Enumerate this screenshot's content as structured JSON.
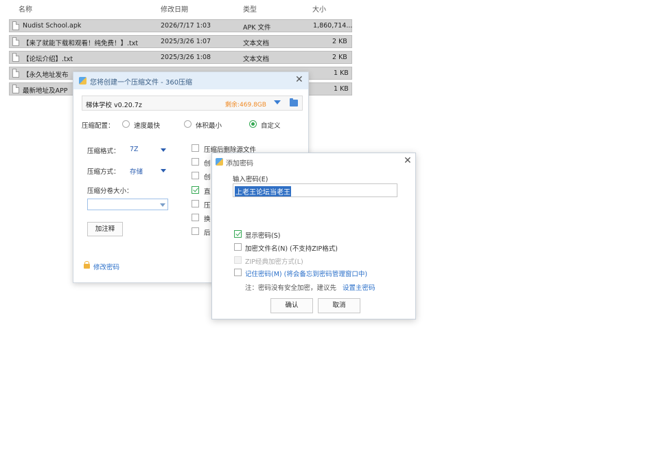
{
  "explorer": {
    "columns": [
      "名称",
      "修改日期",
      "类型",
      "大小"
    ],
    "files": [
      {
        "name": "Nudist School.apk",
        "date": "2026/7/17 1:03",
        "type": "APK 文件",
        "size": "1,860,714..."
      },
      {
        "name": "【来了就能下载和观看！纯免费！】.txt",
        "date": "2025/3/26 1:07",
        "type": "文本文档",
        "size": "2 KB"
      },
      {
        "name": "【论坛介绍】.txt",
        "date": "2025/3/26 1:08",
        "type": "文本文档",
        "size": "2 KB"
      },
      {
        "name": "【永久地址发布",
        "date": "",
        "type": "",
        "size": "1 KB"
      },
      {
        "name": "最新地址及APP",
        "date": "",
        "type": "",
        "size": "1 KB"
      }
    ]
  },
  "dialog360": {
    "title": "您将创建一个压缩文件 - 360压缩",
    "archive_name": "梯体学校  v0.20.7z",
    "free_space": "剩余:469.8GB",
    "config_label": "压缩配置：",
    "options": [
      "速度最快",
      "体积最小",
      "自定义"
    ],
    "selected_option": "自定义",
    "format_label": "压缩格式：",
    "format_value": "7Z",
    "method_label": "压缩方式：",
    "method_value": "存储",
    "split_label": "压缩分卷大小：",
    "split_value": "",
    "comment_button": "加注释",
    "change_password": "修改密码",
    "checkboxes": [
      {
        "label": "压缩后删除源文件",
        "checked": false
      },
      {
        "label": "创",
        "checked": false
      },
      {
        "label": "创",
        "checked": false
      },
      {
        "label": "直",
        "checked": true
      },
      {
        "label": "压",
        "checked": false
      },
      {
        "label": "换",
        "checked": false
      },
      {
        "label": "后",
        "checked": false
      }
    ]
  },
  "password_dialog": {
    "title": "添加密码",
    "input_label": "输入密码(E)",
    "password_value": "上老王论坛当老王",
    "show_password": "显示密码(S)",
    "encrypt_names": "加密文件名(N) (不支持ZIP格式)",
    "zip_classic": "ZIP经典加密方式(L)",
    "remember": "记住密码(M) (将会备忘到密码管理窗口中)",
    "note_prefix": "注：密码没有安全加密，建议先",
    "note_link": "设置主密码",
    "confirm": "确认",
    "cancel": "取消"
  },
  "colors": {
    "accent": "#2a6fc9",
    "checked": "#34a853",
    "free_space": "#f08a24",
    "selection": "#2f6fc4"
  }
}
